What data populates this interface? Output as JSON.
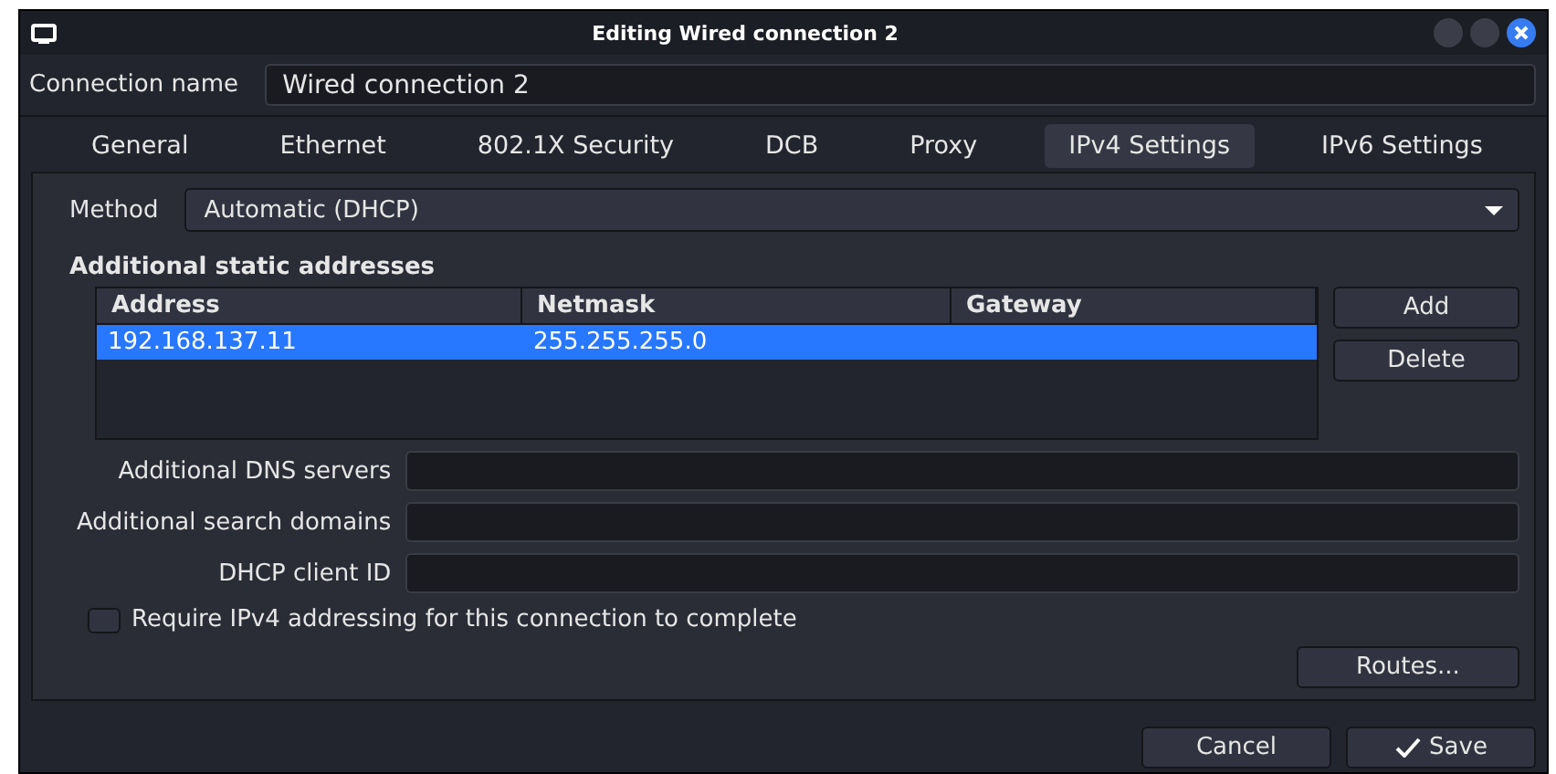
{
  "window": {
    "title": "Editing Wired connection 2"
  },
  "connection_name": {
    "label": "Connection name",
    "value": "Wired connection 2"
  },
  "tabs": [
    {
      "label": "General",
      "selected": false
    },
    {
      "label": "Ethernet",
      "selected": false
    },
    {
      "label": "802.1X Security",
      "selected": false
    },
    {
      "label": "DCB",
      "selected": false
    },
    {
      "label": "Proxy",
      "selected": false
    },
    {
      "label": "IPv4 Settings",
      "selected": true
    },
    {
      "label": "IPv6 Settings",
      "selected": false
    }
  ],
  "method": {
    "label": "Method",
    "value": "Automatic (DHCP)"
  },
  "addresses": {
    "title": "Additional static addresses",
    "columns": [
      "Address",
      "Netmask",
      "Gateway"
    ],
    "rows": [
      {
        "cells": [
          "192.168.137.11",
          "255.255.255.0"
        ],
        "selected": true
      }
    ],
    "buttons": [
      "Add",
      "Delete"
    ]
  },
  "fields": [
    {
      "label": "Additional DNS servers"
    },
    {
      "label": "Additional search domains"
    },
    {
      "label": "DHCP client ID"
    }
  ],
  "require_ipv4": {
    "label": "Require IPv4 addressing for this connection to complete",
    "checked": false
  },
  "routes_button": "Routes...",
  "buttons": [
    {
      "label": "Cancel",
      "kind": "plain"
    },
    {
      "label": "Save",
      "kind": "confirm"
    }
  ]
}
